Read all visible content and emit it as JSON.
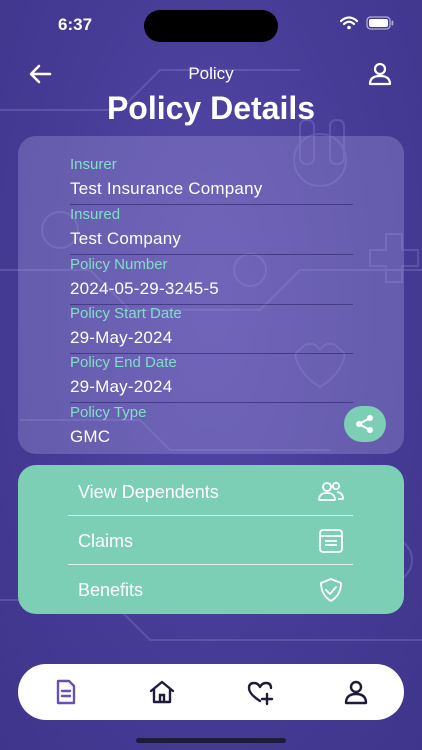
{
  "status_bar": {
    "time": "6:37"
  },
  "header": {
    "title": "Policy"
  },
  "page_title": "Policy Details",
  "details": [
    {
      "label": "Insurer",
      "value": "Test Insurance Company"
    },
    {
      "label": "Insured",
      "value": "Test Company"
    },
    {
      "label": "Policy Number",
      "value": "2024-05-29-3245-5"
    },
    {
      "label": "Policy Start Date",
      "value": "29-May-2024"
    },
    {
      "label": "Policy End Date",
      "value": "29-May-2024"
    },
    {
      "label": "Policy Type",
      "value": "GMC"
    }
  ],
  "actions": [
    {
      "label": "View Dependents",
      "icon": "users-icon"
    },
    {
      "label": "Claims",
      "icon": "claims-icon"
    },
    {
      "label": "Benefits",
      "icon": "shield-check-icon"
    }
  ],
  "nav": [
    {
      "icon": "policy-document-icon",
      "active": true
    },
    {
      "icon": "home-icon",
      "active": false
    },
    {
      "icon": "heart-plus-icon",
      "active": false
    },
    {
      "icon": "profile-icon",
      "active": false
    }
  ],
  "colors": {
    "background": "#4a3f9a",
    "accent_teal": "#7ccfb4",
    "label_teal": "#7fe0c6",
    "nav_active": "#6a4fb0",
    "nav_inactive": "#1f1b3a"
  }
}
